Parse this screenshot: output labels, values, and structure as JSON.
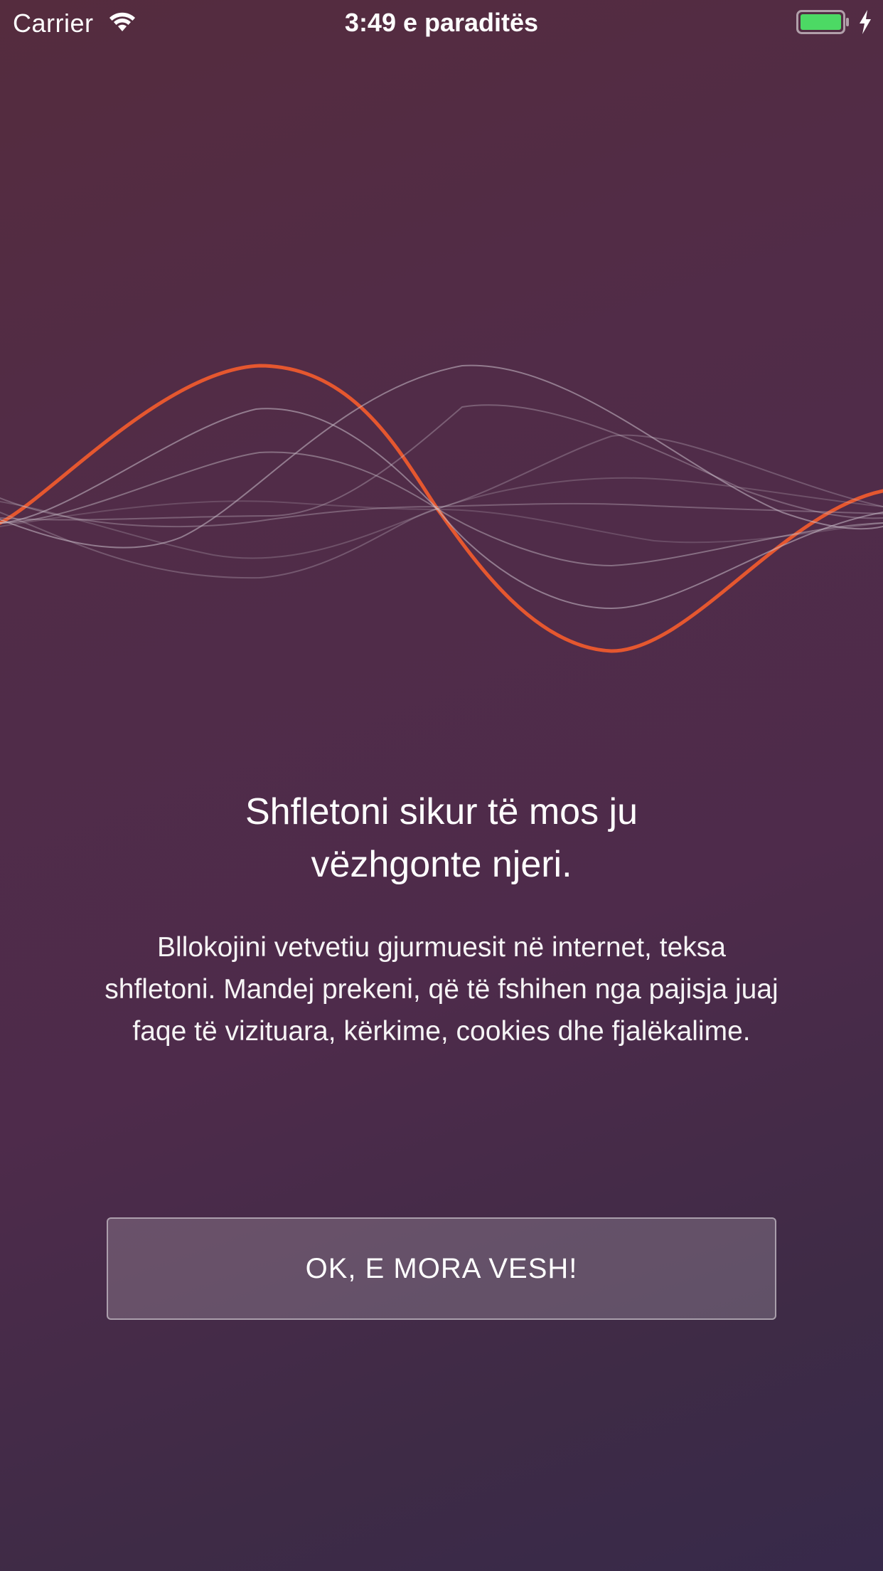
{
  "status_bar": {
    "carrier": "Carrier",
    "time": "3:49 e paraditës",
    "icons": [
      "wifi-icon",
      "battery-icon",
      "charging-icon"
    ],
    "battery_color": "#4cd964"
  },
  "onboarding": {
    "headline_line1": "Shfletoni sikur të mos ju",
    "headline_line2": "vëzhgonte njeri.",
    "body": "Bllokojini vetvetiu gjurmuesit në internet, teksa shfletoni. Mandej prekeni, që të fshihen nga pajisja juaj faqe të vizituara, kërkime, cookies dhe fjalëkalime.",
    "button_label": "OK, E MORA VESH!"
  },
  "colors": {
    "accent_wave": "#e5572f",
    "background_top": "#552c3e",
    "background_bottom": "#37294a"
  }
}
